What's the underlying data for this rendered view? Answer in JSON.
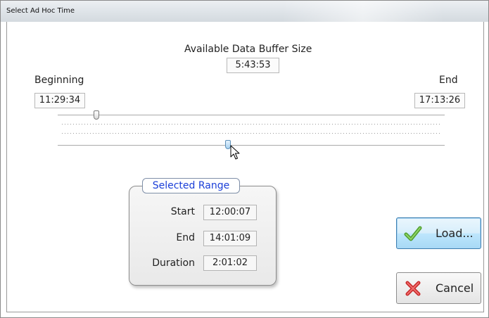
{
  "window": {
    "title": "Select Ad Hoc Time"
  },
  "buffer": {
    "label": "Available Data Buffer Size",
    "value": "5:43:53"
  },
  "beginning": {
    "label": "Beginning",
    "value": "11:29:34"
  },
  "end": {
    "label": "End",
    "value": "17:13:26"
  },
  "sliders": {
    "upper_thumb_fraction": 0.1,
    "lower_thumb_fraction": 0.44
  },
  "selected_range": {
    "title": "Selected Range",
    "rows": [
      {
        "label": "Start",
        "value": "12:00:07"
      },
      {
        "label": "End",
        "value": "14:01:09"
      },
      {
        "label": "Duration",
        "value": "2:01:02"
      }
    ]
  },
  "buttons": {
    "load": {
      "label": "Load...",
      "icon": "check-icon",
      "color": "#5cae3a"
    },
    "cancel": {
      "label": "Cancel",
      "icon": "x-icon",
      "color": "#d83a3a"
    }
  }
}
